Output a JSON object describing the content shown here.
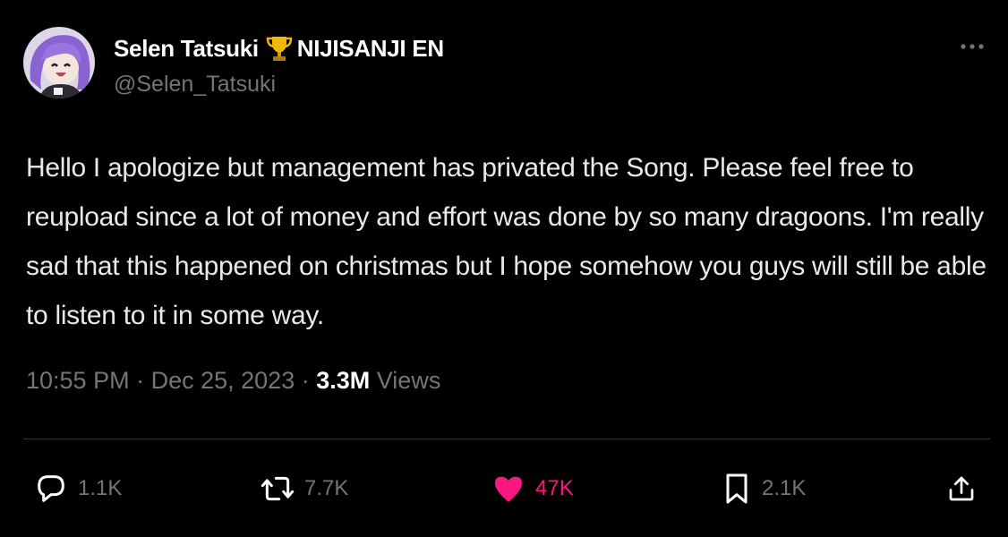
{
  "post": {
    "author": {
      "display_name": "Selen Tatsuki",
      "badge_icon": "trophy-icon",
      "affiliation": "NIJISANJI EN",
      "handle": "@Selen_Tatsuki"
    },
    "text": "Hello I apologize but management has privated the Song. Please feel free to reupload since a lot of money and effort was done by so many dragoons. I'm really sad that this happened on christmas but I hope somehow you guys will still be able to listen to it in some way.",
    "time": "10:55 PM",
    "separator": "·",
    "date": "Dec 25, 2023",
    "views_count": "3.3M",
    "views_label": "Views"
  },
  "actions": {
    "reply": {
      "icon": "reply-icon",
      "count": "1.1K"
    },
    "retweet": {
      "icon": "retweet-icon",
      "count": "7.7K"
    },
    "like": {
      "icon": "heart-icon",
      "count": "47K",
      "liked": true
    },
    "bookmark": {
      "icon": "bookmark-icon",
      "count": "2.1K"
    },
    "share": {
      "icon": "share-icon"
    }
  },
  "colors": {
    "background": "#000000",
    "text": "#e7e9ea",
    "secondary_text": "#71767b",
    "like_accent": "#f91880",
    "divider": "#2f3336"
  }
}
